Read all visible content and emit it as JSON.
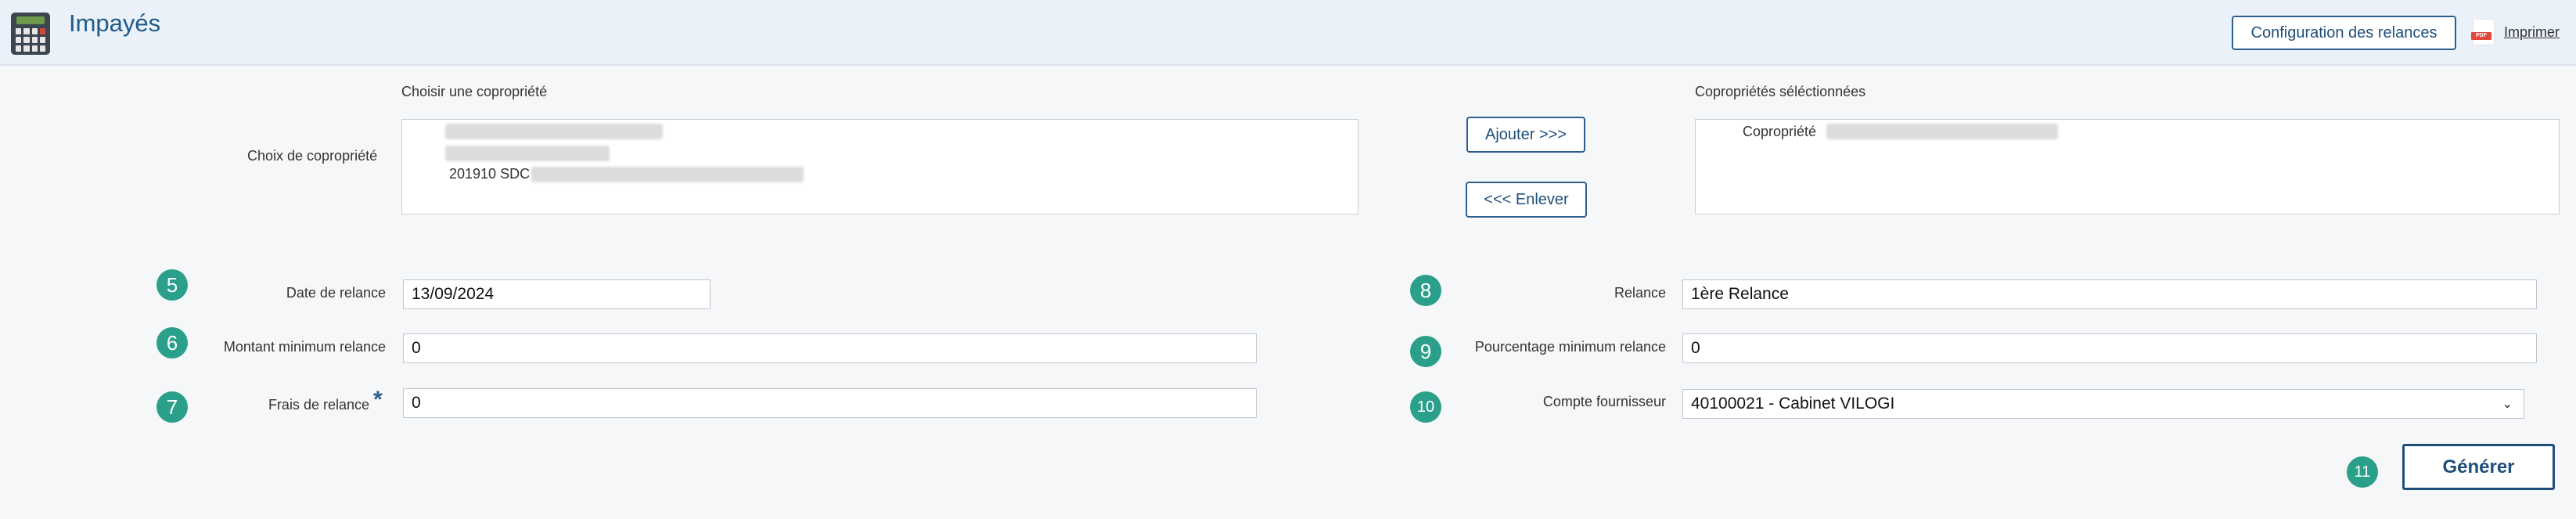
{
  "header": {
    "title": "Impayés",
    "config_button": "Configuration des relances",
    "print_label": "Imprimer",
    "print_icon_text": "PDF"
  },
  "copro": {
    "choose_heading": "Choisir une copropriété",
    "choice_label": "Choix de copropriété",
    "available_items": [
      "201910 SDC"
    ],
    "add_button": "Ajouter >>>",
    "remove_button": "<<< Enlever",
    "selected_heading": "Copropriétés séléctionnées",
    "selected_items": [
      "Copropriété"
    ]
  },
  "form": {
    "date": {
      "num": "5",
      "label": "Date de relance",
      "value": "13/09/2024"
    },
    "montant": {
      "num": "6",
      "label": "Montant minimum relance",
      "value": "0"
    },
    "frais": {
      "num": "7",
      "label": "Frais de relance",
      "required": "*",
      "value": "0"
    },
    "relance": {
      "num": "8",
      "label": "Relance",
      "value": "1ère Relance"
    },
    "pourcentage": {
      "num": "9",
      "label": "Pourcentage minimum relance",
      "value": "0"
    },
    "compte": {
      "num": "10",
      "label": "Compte fournisseur",
      "value": "40100021 - Cabinet VILOGI"
    }
  },
  "generate": {
    "num": "11",
    "label": "Générer"
  },
  "colors": {
    "accent": "#1f4e7a",
    "badge": "#2aa08a",
    "header_bg": "#eaf1f8"
  }
}
